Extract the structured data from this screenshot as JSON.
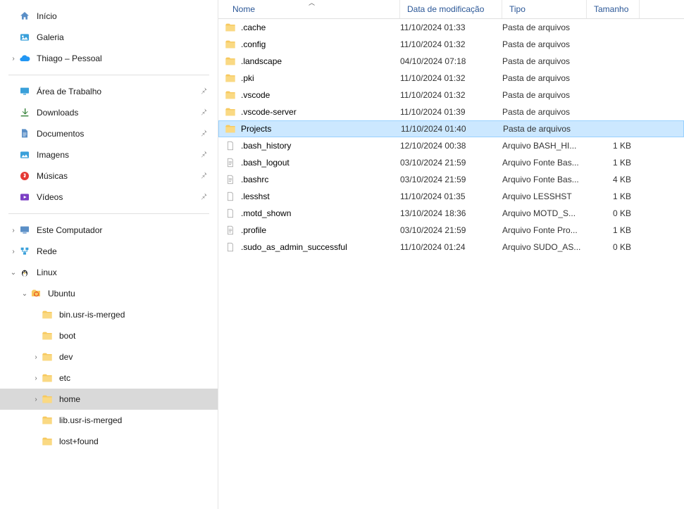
{
  "sidebar": {
    "top_items": [
      {
        "label": "Início",
        "icon": "home"
      },
      {
        "label": "Galeria",
        "icon": "gallery"
      },
      {
        "label": "Thiago – Pessoal",
        "icon": "cloud",
        "chevron": true
      }
    ],
    "quick_access": [
      {
        "label": "Área de Trabalho",
        "icon": "desktop",
        "pin": true
      },
      {
        "label": "Downloads",
        "icon": "download",
        "pin": true
      },
      {
        "label": "Documentos",
        "icon": "documents",
        "pin": true
      },
      {
        "label": "Imagens",
        "icon": "images",
        "pin": true
      },
      {
        "label": "Músicas",
        "icon": "music",
        "pin": true
      },
      {
        "label": "Vídeos",
        "icon": "videos",
        "pin": true
      }
    ],
    "tree": [
      {
        "label": "Este Computador",
        "icon": "computer",
        "chevron": "right",
        "indent": 0
      },
      {
        "label": "Rede",
        "icon": "network",
        "chevron": "right",
        "indent": 0
      },
      {
        "label": "Linux",
        "icon": "linux",
        "chevron": "down",
        "indent": 0
      },
      {
        "label": "Ubuntu",
        "icon": "ubuntu",
        "chevron": "down",
        "indent": 1
      },
      {
        "label": "bin.usr-is-merged",
        "icon": "folder",
        "chevron": "",
        "indent": 2
      },
      {
        "label": "boot",
        "icon": "folder",
        "chevron": "",
        "indent": 2
      },
      {
        "label": "dev",
        "icon": "folder",
        "chevron": "right",
        "indent": 2
      },
      {
        "label": "etc",
        "icon": "folder",
        "chevron": "right",
        "indent": 2
      },
      {
        "label": "home",
        "icon": "folder",
        "chevron": "right",
        "indent": 2,
        "selected": true
      },
      {
        "label": "lib.usr-is-merged",
        "icon": "folder",
        "chevron": "",
        "indent": 2
      },
      {
        "label": "lost+found",
        "icon": "folder",
        "chevron": "",
        "indent": 2
      }
    ]
  },
  "columns": {
    "name": "Nome",
    "date": "Data de modificação",
    "type": "Tipo",
    "size": "Tamanho"
  },
  "files": [
    {
      "name": ".cache",
      "date": "11/10/2024 01:33",
      "type": "Pasta de arquivos",
      "size": "",
      "icon": "folder"
    },
    {
      "name": ".config",
      "date": "11/10/2024 01:32",
      "type": "Pasta de arquivos",
      "size": "",
      "icon": "folder"
    },
    {
      "name": ".landscape",
      "date": "04/10/2024 07:18",
      "type": "Pasta de arquivos",
      "size": "",
      "icon": "folder"
    },
    {
      "name": ".pki",
      "date": "11/10/2024 01:32",
      "type": "Pasta de arquivos",
      "size": "",
      "icon": "folder"
    },
    {
      "name": ".vscode",
      "date": "11/10/2024 01:32",
      "type": "Pasta de arquivos",
      "size": "",
      "icon": "folder"
    },
    {
      "name": ".vscode-server",
      "date": "11/10/2024 01:39",
      "type": "Pasta de arquivos",
      "size": "",
      "icon": "folder"
    },
    {
      "name": "Projects",
      "date": "11/10/2024 01:40",
      "type": "Pasta de arquivos",
      "size": "",
      "icon": "folder",
      "selected": true
    },
    {
      "name": ".bash_history",
      "date": "12/10/2024 00:38",
      "type": "Arquivo BASH_HI...",
      "size": "1 KB",
      "icon": "file"
    },
    {
      "name": ".bash_logout",
      "date": "03/10/2024 21:59",
      "type": "Arquivo Fonte Bas...",
      "size": "1 KB",
      "icon": "file-lines"
    },
    {
      "name": ".bashrc",
      "date": "03/10/2024 21:59",
      "type": "Arquivo Fonte Bas...",
      "size": "4 KB",
      "icon": "file-lines"
    },
    {
      "name": ".lesshst",
      "date": "11/10/2024 01:35",
      "type": "Arquivo LESSHST",
      "size": "1 KB",
      "icon": "file"
    },
    {
      "name": ".motd_shown",
      "date": "13/10/2024 18:36",
      "type": "Arquivo MOTD_S...",
      "size": "0 KB",
      "icon": "file"
    },
    {
      "name": ".profile",
      "date": "03/10/2024 21:59",
      "type": "Arquivo Fonte Pro...",
      "size": "1 KB",
      "icon": "file-lines"
    },
    {
      "name": ".sudo_as_admin_successful",
      "date": "11/10/2024 01:24",
      "type": "Arquivo SUDO_AS...",
      "size": "0 KB",
      "icon": "file"
    }
  ]
}
